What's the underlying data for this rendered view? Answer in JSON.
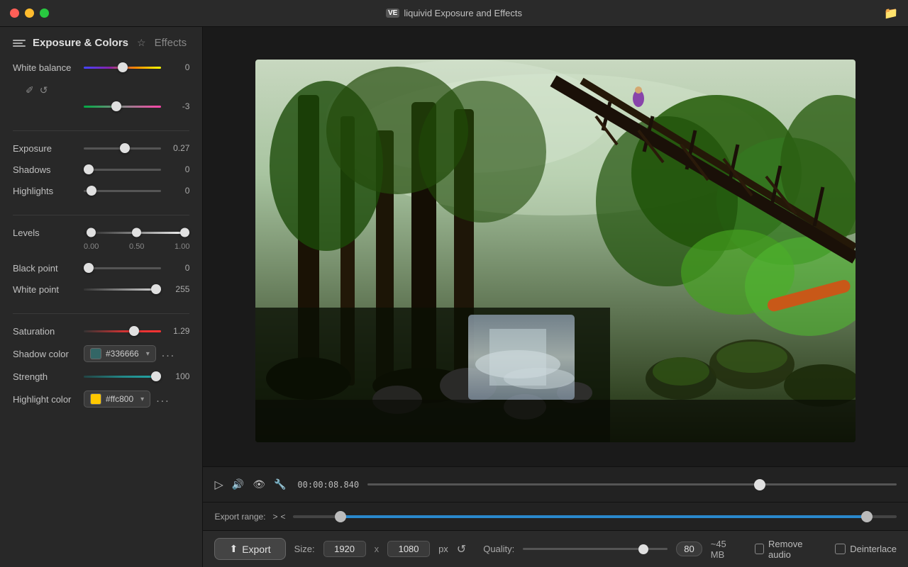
{
  "titlebar": {
    "icon_label": "VE",
    "title": "liquivid Exposure and Effects",
    "folder_icon": "📁"
  },
  "tabs": {
    "active": "Exposure & Colors",
    "inactive": "Effects",
    "star_char": "☆"
  },
  "white_balance": {
    "label": "White balance",
    "value1": "0",
    "value2": "-3",
    "eyedropper_icon": "🖉",
    "reset_icon": "↺"
  },
  "exposure": {
    "label": "Exposure",
    "value": "0.27"
  },
  "shadows": {
    "label": "Shadows",
    "value": "0"
  },
  "highlights": {
    "label": "Highlights",
    "value": "0"
  },
  "levels": {
    "label": "Levels",
    "val_min": "0.00",
    "val_mid": "0.50",
    "val_max": "1.00"
  },
  "black_point": {
    "label": "Black point",
    "value": "0"
  },
  "white_point": {
    "label": "White point",
    "value": "255"
  },
  "saturation": {
    "label": "Saturation",
    "value": "1.29"
  },
  "shadow_color": {
    "label": "Shadow color",
    "color_hex": "#336666",
    "color_display": "#336666",
    "more_icon": "..."
  },
  "strength": {
    "label": "Strength",
    "value": "100"
  },
  "highlight_color": {
    "label": "Highlight color",
    "color_hex": "#ffc800",
    "color_display": "#ffc800",
    "more_icon": "..."
  },
  "playback": {
    "play_icon": "▷",
    "volume_icon": "🔊",
    "eye_icon": "👁",
    "wrench_icon": "🔧",
    "timecode": "00:00:08.840"
  },
  "export_range": {
    "label": "Export range:",
    "left_arrow": ">",
    "right_arrow": "<"
  },
  "export_bar": {
    "export_label": "Export",
    "export_icon": "⬆",
    "size_label": "Size:",
    "width": "1920",
    "x_sep": "x",
    "height": "1080",
    "px_label": "px",
    "reset_icon": "↺",
    "quality_label": "Quality:",
    "quality_value": "80",
    "filesize": "~45 MB",
    "remove_audio_label": "Remove audio",
    "deinterlace_label": "Deinterlace"
  }
}
